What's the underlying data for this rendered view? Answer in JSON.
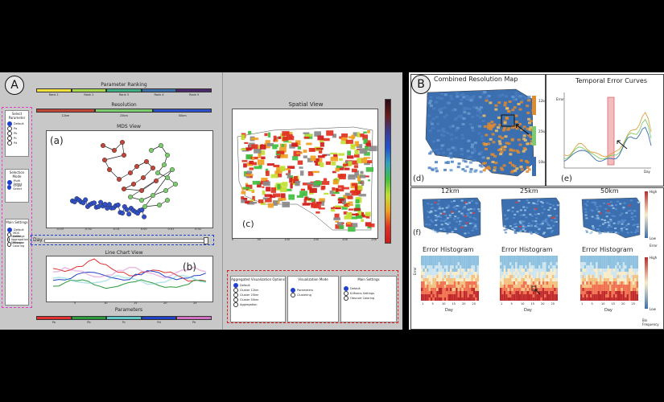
{
  "panels": {
    "a_label": "A",
    "b_label": "B"
  },
  "left": {
    "param_ranking": {
      "title": "Parameter Ranking",
      "ranks": [
        "Rank 1",
        "Rank 2",
        "Rank 3",
        "Rank 4",
        "Rank 5"
      ],
      "colors": [
        "#f4e23a",
        "#a9d94a",
        "#3fae84",
        "#3a6fa8",
        "#4a2a6a"
      ]
    },
    "resolution": {
      "title": "Resolution",
      "levels": [
        "12km",
        "25km",
        "50km"
      ],
      "colors": [
        "#c0463a",
        "#7ccb6e",
        "#3050c8"
      ]
    },
    "select_parameter": {
      "title": "Select Parameter",
      "items": [
        "Default",
        "Pa",
        "Pb",
        "Pc",
        "Pd"
      ]
    },
    "selection_mode": {
      "title": "Selection Mode",
      "items": [
        "Multi Select",
        "Single Select"
      ]
    },
    "main_settings": {
      "title": "Main Settings",
      "items": [
        "Default",
        "MDS Settings",
        "Spatial Aggregation Settings",
        "Obscure Coloring"
      ]
    },
    "mds": {
      "title": "MDS View",
      "label": "(a)",
      "xticks": [
        "-0.03",
        "-0.02",
        "-0.01",
        "0.00",
        "0.01",
        "0.02"
      ]
    },
    "day_slider": {
      "label": "Day"
    },
    "line_chart": {
      "title": "Line Chart View",
      "label": "(b)",
      "xlabel": "Parameters",
      "xticks": [
        "5",
        "10",
        "15",
        "20",
        "25"
      ],
      "params": [
        "Pa",
        "Pb",
        "Pc",
        "Pd",
        "Pe"
      ],
      "param_colors": [
        "#e03030",
        "#2a9a3a",
        "#5fc8c8",
        "#2040c8",
        "#d070c0"
      ]
    },
    "spatial": {
      "title": "Spatial View",
      "label": "(c)",
      "xticks": [
        "0",
        "50",
        "100",
        "150",
        "200",
        "250"
      ]
    },
    "settings": {
      "aggregated": {
        "title": "Aggregated Visualization Options",
        "items": [
          "Default",
          "Cluster 12km",
          "Cluster 25km",
          "Cluster 50km",
          "Aggregation"
        ]
      },
      "visual_mode": {
        "title": "Visualization Mode",
        "items": [
          "Parameters",
          "Clustering"
        ]
      },
      "main": {
        "title": "Main Settings",
        "items": [
          "Default",
          "K-Means Settings",
          "Obscure Coloring"
        ]
      }
    }
  },
  "right": {
    "combined": {
      "title": "Combined Resolution Map",
      "label": "(d)",
      "legend": [
        "12km",
        "25km",
        "50km"
      ]
    },
    "temporal": {
      "title": "Temporal Error Curves",
      "label": "(e)",
      "xlabel": "Day",
      "ylabel": "Error"
    },
    "maps": {
      "label": "(f)",
      "titles": [
        "12km",
        "25km",
        "50km"
      ],
      "legend_high": "High",
      "legend_low": "Low",
      "legend_title": "Error"
    },
    "histograms": {
      "title": "Error Histogram",
      "xlabel": "Day",
      "ylabel": "Error",
      "legend_high": "High",
      "legend_low": "Low",
      "legend_title": "Bin Frequency",
      "xticks": [
        "1",
        "5",
        "10",
        "15",
        "20",
        "25"
      ]
    }
  }
}
